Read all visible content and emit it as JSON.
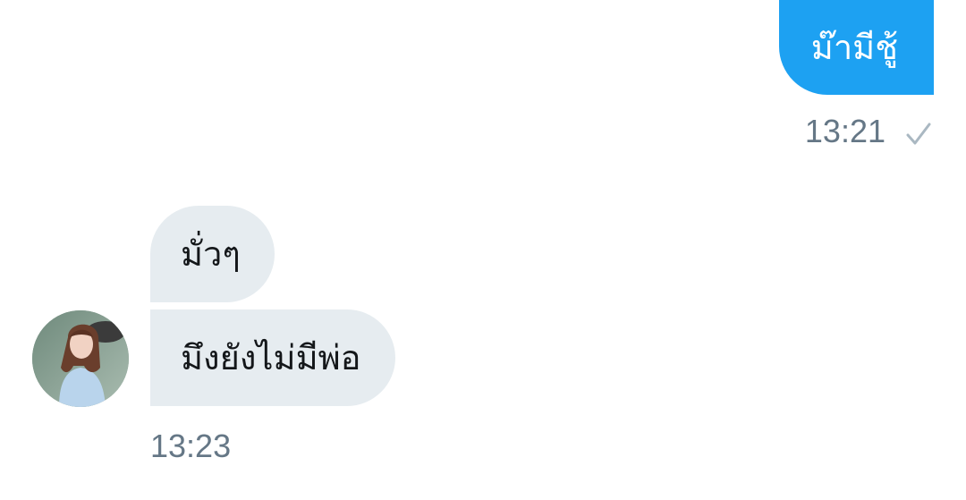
{
  "conversation": {
    "outgoing": {
      "text": "ม๊ามีชู้",
      "time": "13:21",
      "status_icon": "checkmark-icon"
    },
    "incoming": {
      "messages": [
        {
          "text": "มั่วๆ"
        },
        {
          "text": "มึงยังไม่มีพ่อ"
        }
      ],
      "time": "13:23",
      "avatar_icon": "user-avatar"
    }
  },
  "colors": {
    "outgoing_bubble": "#1da1f2",
    "incoming_bubble": "#e6ecf0",
    "timestamp": "#657786",
    "check": "#aab8c2"
  }
}
